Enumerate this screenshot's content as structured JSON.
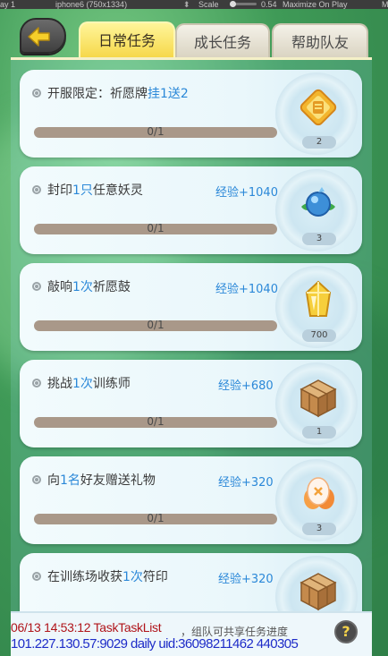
{
  "editor_bar": {
    "display": "ay 1",
    "resolution": "iphone6 (750x1334)",
    "scale_label": "Scale",
    "scale_value": "0.54",
    "maximize": "Maximize On Play",
    "extra": "M"
  },
  "tabs": {
    "daily": "日常任务",
    "growth": "成长任务",
    "help": "帮助队友",
    "active": "daily"
  },
  "tasks": [
    {
      "prefix": "开服限定：祈愿牌",
      "highlight": "挂1送2",
      "suffix": "",
      "exp": "",
      "progress": "0/1",
      "reward_count": "2",
      "reward_icon": "token-icon"
    },
    {
      "prefix": "封印",
      "highlight": "1只",
      "suffix": "任意妖灵",
      "exp": "经验+1040",
      "progress": "0/1",
      "reward_count": "3",
      "reward_icon": "blue-orb-icon"
    },
    {
      "prefix": "敲响",
      "highlight": "1次",
      "suffix": "祈愿鼓",
      "exp": "经验+1040",
      "progress": "0/1",
      "reward_count": "700",
      "reward_icon": "gold-crystal-icon"
    },
    {
      "prefix": "挑战",
      "highlight": "1次",
      "suffix": "训练师",
      "exp": "经验+680",
      "progress": "0/1",
      "reward_count": "1",
      "reward_icon": "wooden-crate-icon"
    },
    {
      "prefix": "向",
      "highlight": "1名",
      "suffix": "好友赠送礼物",
      "exp": "经验+320",
      "progress": "0/1",
      "reward_count": "3",
      "reward_icon": "egg-icon"
    },
    {
      "prefix": "在训练场收获",
      "highlight": "1次",
      "suffix": "符印",
      "exp": "经验+320",
      "progress": "",
      "reward_count": "",
      "reward_icon": "wooden-crate-icon"
    }
  ],
  "footer": {
    "tip": "，组队可共享任务进度",
    "help_label": "?"
  },
  "debug": {
    "line1": "06/13 14:53:12 TaskTaskList",
    "line2": "101.227.130.57:9029 daily uid:36098211462 440305"
  },
  "colors": {
    "highlight": "#2b88d8",
    "debug_red": "#b0141a",
    "debug_blue": "#1e2cc8"
  }
}
